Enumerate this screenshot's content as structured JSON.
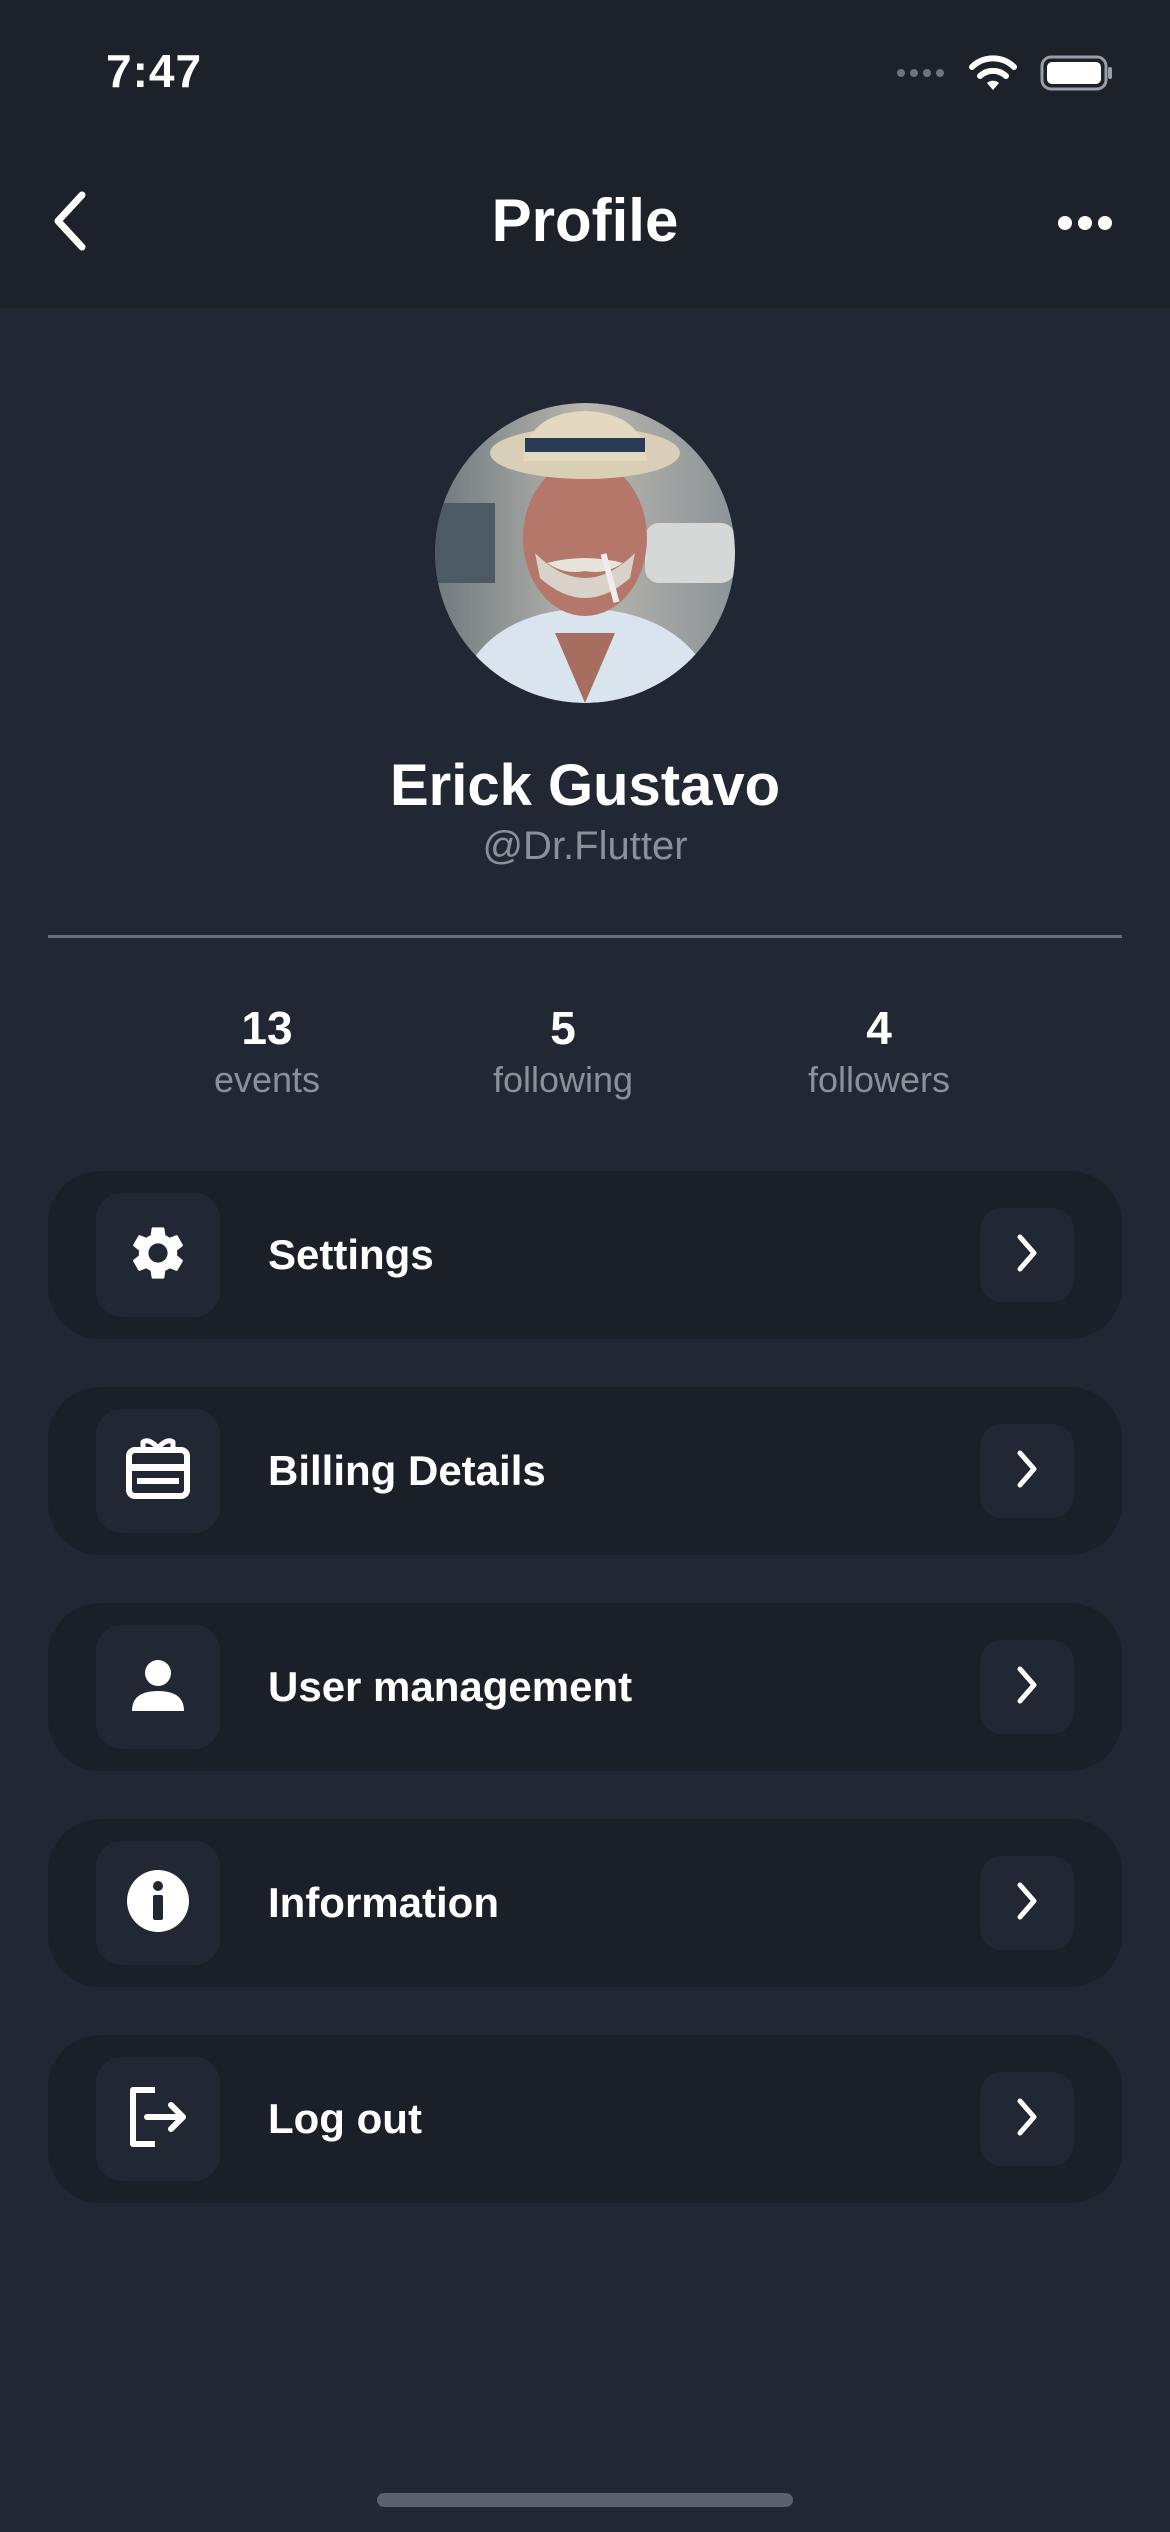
{
  "status_bar": {
    "time": "7:47"
  },
  "nav": {
    "title": "Profile"
  },
  "profile": {
    "name": "Erick Gustavo",
    "handle": "@Dr.Flutter"
  },
  "stats": [
    {
      "value": "13",
      "label": "events"
    },
    {
      "value": "5",
      "label": "following"
    },
    {
      "value": "4",
      "label": "followers"
    }
  ],
  "menu": [
    {
      "label": "Settings",
      "icon": "gear-icon"
    },
    {
      "label": "Billing Details",
      "icon": "wallet-icon"
    },
    {
      "label": "User management",
      "icon": "user-icon"
    },
    {
      "label": "Information",
      "icon": "info-icon"
    },
    {
      "label": "Log out",
      "icon": "logout-icon"
    }
  ],
  "colors": {
    "background": "#222833",
    "card": "#1b1f28",
    "text": "#ffffff",
    "muted": "#8c9099"
  }
}
